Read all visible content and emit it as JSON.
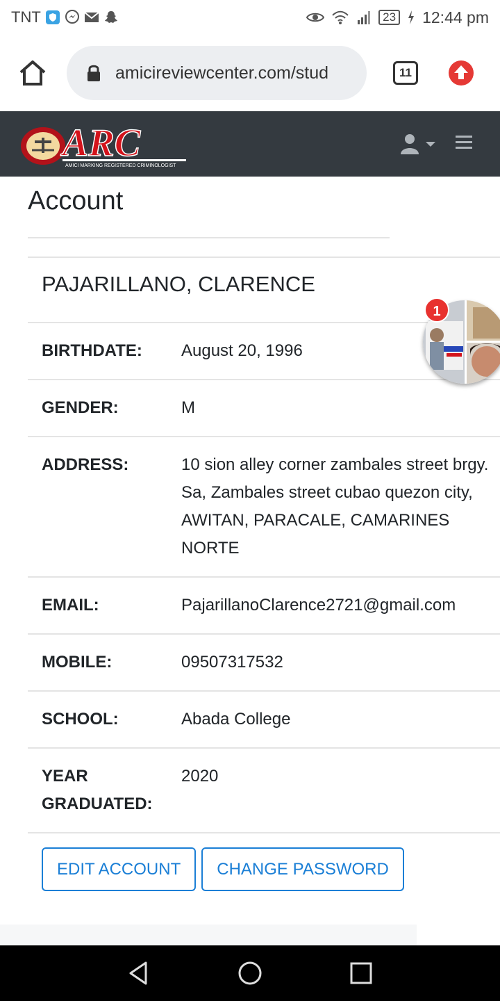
{
  "status_bar": {
    "carrier": "TNT",
    "battery": "23",
    "time": "12:44 pm",
    "icons": [
      "shield-icon",
      "messenger-icon",
      "mail-icon",
      "snapchat-icon",
      "eye-icon",
      "wifi-icon",
      "signal-icon",
      "charging-icon"
    ]
  },
  "browser": {
    "url": "amicireviewcenter.com/stud",
    "tab_count": "11"
  },
  "site": {
    "logo_text": "ARC",
    "logo_tagline": "AMICI MARKING REGISTERED CRIMINOLOGIST"
  },
  "page": {
    "title": "Account",
    "name": "PAJARILLANO, CLARENCE"
  },
  "fields": [
    {
      "label": "BIRTHDATE:",
      "value": "August 20, 1996"
    },
    {
      "label": "GENDER:",
      "value": "M"
    },
    {
      "label": "ADDRESS:",
      "value": "10 sion alley corner zambales street brgy. Sa, Zambales street cubao quezon city, AWITAN, PARACALE, CAMARINES NORTE"
    },
    {
      "label": "EMAIL:",
      "value": "PajarillanoClarence2721@gmail.com"
    },
    {
      "label": "MOBILE:",
      "value": "09507317532"
    },
    {
      "label": "SCHOOL:",
      "value": "Abada College"
    },
    {
      "label": "YEAR GRADUATED:",
      "value": "2020"
    }
  ],
  "actions": {
    "edit_account": "EDIT ACCOUNT",
    "change_password": "CHANGE PASSWORD"
  },
  "chat_head": {
    "badge_count": "1"
  },
  "colors": {
    "navbar": "#343a40",
    "accent": "#1b7fd6",
    "badge": "#e8322f"
  }
}
